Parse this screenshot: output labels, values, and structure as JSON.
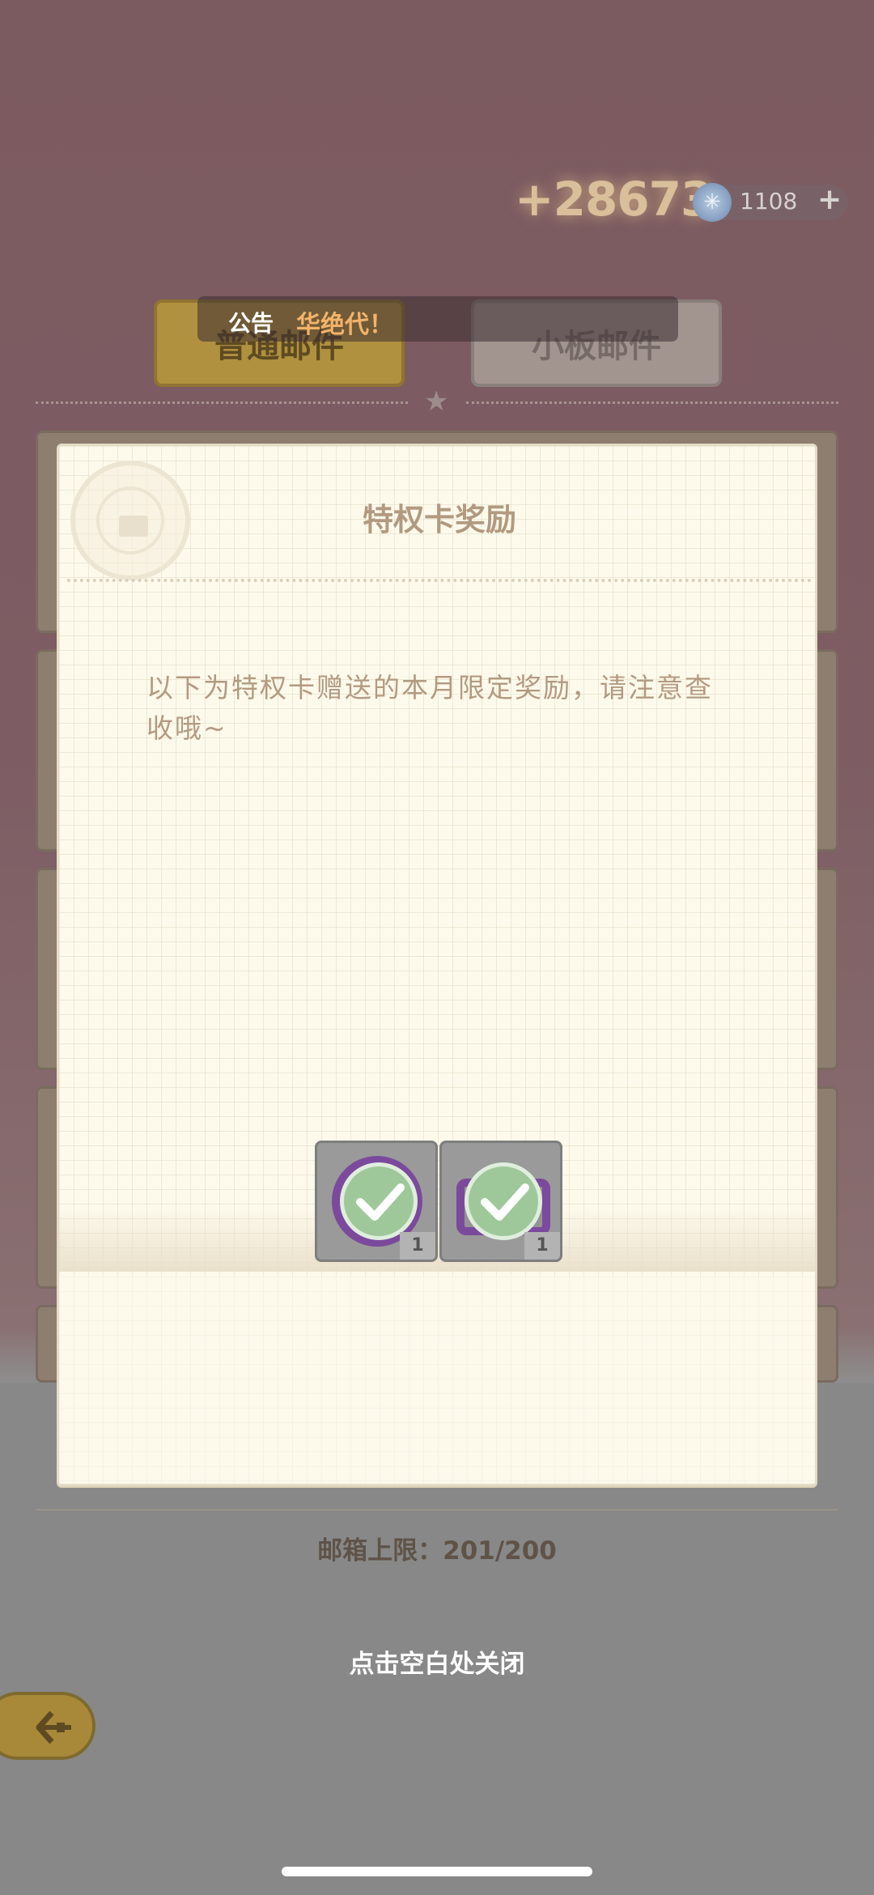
{
  "header": {
    "score": "+28673",
    "gem_count": "1108",
    "gem_icon": "star-gem-icon",
    "plus_label": "+"
  },
  "tabs": [
    {
      "label": "普通邮件",
      "active": true
    },
    {
      "label": "小板邮件",
      "active": false
    }
  ],
  "announcement": {
    "label": "公告",
    "text": "华绝代！"
  },
  "modal": {
    "title": "特权卡奖励",
    "body": "以下为特权卡赠送的本月限定奖励，请注意查收哦~",
    "items": [
      {
        "icon": "purple-flower-frame-icon",
        "qty": "1",
        "claimed": true
      },
      {
        "icon": "purple-ticket-icon",
        "qty": "1",
        "claimed": true
      }
    ]
  },
  "mailbox": {
    "capacity": "邮箱上限：201/200"
  },
  "close_hint": "点击空白处关闭",
  "colors": {
    "accent_gold": "#b0913f",
    "modal_bg": "#fdfaec",
    "title_text": "#b19a80",
    "check_green": "#9fc89a",
    "item_purple": "#7b4a9c"
  }
}
